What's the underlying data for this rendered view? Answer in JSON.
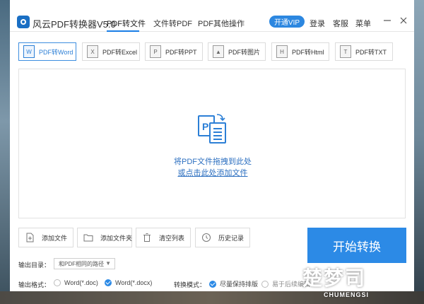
{
  "app": {
    "title": "风云PDF转换器V5.0"
  },
  "nav": {
    "tabs": [
      "PDF转文件",
      "文件转PDF",
      "PDF其他操作"
    ],
    "active_tab": 0,
    "vip_label": "开通VIP",
    "login_label": "登录",
    "service_label": "客服",
    "menu_label": "菜单"
  },
  "subtabs": [
    {
      "label": "PDF转Word",
      "icon": "word-file-icon",
      "active": true
    },
    {
      "label": "PDF转Excel",
      "icon": "excel-file-icon",
      "active": false
    },
    {
      "label": "PDF转PPT",
      "icon": "ppt-file-icon",
      "active": false
    },
    {
      "label": "PDF转图片",
      "icon": "image-file-icon",
      "active": false
    },
    {
      "label": "PDF转Html",
      "icon": "html-file-icon",
      "active": false
    },
    {
      "label": "PDF转TXT",
      "icon": "txt-file-icon",
      "active": false
    }
  ],
  "drop": {
    "line1": "将PDF文件拖拽到此处",
    "line2": "或点击此处添加文件"
  },
  "actions": {
    "add_file": "添加文件",
    "add_folder": "添加文件夹",
    "clear_list": "清空列表",
    "history": "历史记录",
    "start": "开始转换"
  },
  "settings": {
    "output_dir_label": "输出目录：",
    "output_dir_value": "和PDF相同的路径",
    "output_format_label": "输出格式：",
    "format_doc": "Word(*.doc)",
    "format_docx": "Word(*.docx)",
    "convert_mode_label": "转换模式：",
    "mode_keep_layout": "尽量保持排版",
    "mode_easy_edit": "易于后续编辑"
  },
  "watermark": {
    "big": "楚梦司",
    "small": "CHUMENGSI"
  },
  "colors": {
    "accent": "#2c8ae6",
    "link": "#2c6fc0"
  }
}
